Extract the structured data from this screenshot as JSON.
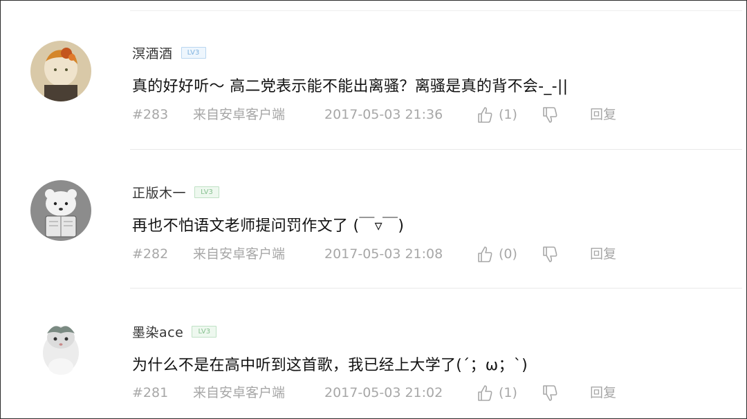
{
  "colors": {
    "background": "#ffffff",
    "username": "#333333",
    "comment_text": "#111111",
    "meta_text": "#a7a7a7",
    "divider": "#e9e9e9"
  },
  "comments": [
    {
      "username": "溟酒酒",
      "level_badge": "LV3",
      "text": "真的好好听～ 高二党表示能不能出离骚？离骚是真的背不会-_-||",
      "floor": "#283",
      "source": "来自安卓客户端",
      "time": "2017-05-03 21:36",
      "likes": "(1)",
      "reply_label": "回复",
      "like_icon": "thumbs-up-icon",
      "dislike_icon": "thumbs-down-icon"
    },
    {
      "username": "正版木一",
      "level_badge": "LV3",
      "text": "再也不怕语文老师提问罚作文了 (￣▿￣)",
      "floor": "#282",
      "source": "来自安卓客户端",
      "time": "2017-05-03 21:08",
      "likes": "(0)",
      "reply_label": "回复",
      "like_icon": "thumbs-up-icon",
      "dislike_icon": "thumbs-down-icon"
    },
    {
      "username": "墨染ace",
      "level_badge": "LV3",
      "text": "为什么不是在高中听到这首歌，我已经上大学了(´；ω；`)",
      "floor": "#281",
      "source": "来自安卓客户端",
      "time": "2017-05-03 21:02",
      "likes": "(1)",
      "reply_label": "回复",
      "like_icon": "thumbs-up-icon",
      "dislike_icon": "thumbs-down-icon"
    }
  ]
}
